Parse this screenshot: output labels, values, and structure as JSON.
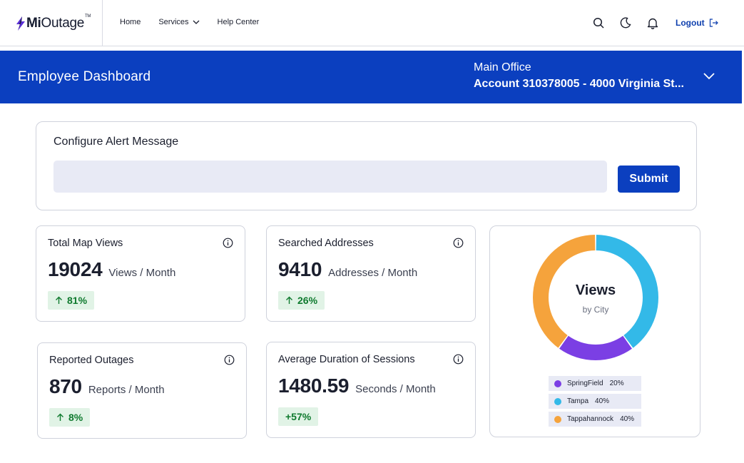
{
  "brand": {
    "logo_bold": "Mi",
    "logo_rest": "Outage",
    "logo_tm": "TM"
  },
  "nav": {
    "links": [
      {
        "label": "Home"
      },
      {
        "label": "Services"
      },
      {
        "label": "Help Center"
      }
    ],
    "icons": [
      "search-icon",
      "moon-icon",
      "bell-icon"
    ],
    "logout_label": "Logout"
  },
  "banner": {
    "title": "Employee Dashboard",
    "office": "Main Office",
    "account": "Account 310378005 - 4000 Virginia St..."
  },
  "alert": {
    "title": "Configure Alert Message",
    "input_value": "",
    "submit_label": "Submit"
  },
  "stats": [
    {
      "title": "Total Map Views",
      "value": "19024",
      "unit": "Views / Month",
      "change": "81%",
      "trend": "up"
    },
    {
      "title": "Searched Addresses",
      "value": "9410",
      "unit": "Addresses / Month",
      "change": "26%",
      "trend": "up"
    },
    {
      "title": "Reported Outages",
      "value": "870",
      "unit": "Reports / Month",
      "change": "8%",
      "trend": "up"
    },
    {
      "title": "Average Duration of Sessions",
      "value": "1480.59",
      "unit": "Seconds / Month",
      "change": "+57%",
      "trend": "none"
    }
  ],
  "donut": {
    "title": "Views",
    "subtitle": "by City",
    "segments": [
      {
        "label": "SpringField",
        "percent_label": "20%",
        "value": 20,
        "color": "#7b3fe4"
      },
      {
        "label": "Tampa",
        "percent_label": "40%",
        "value": 40,
        "color": "#33b9e8"
      },
      {
        "label": "Tappahannock",
        "percent_label": "40%",
        "value": 40,
        "color": "#f5a33c"
      }
    ]
  },
  "colors": {
    "primary": "#0b3fbf",
    "positive_bg": "#e1f3e6",
    "positive_text": "#0f7a2e"
  }
}
